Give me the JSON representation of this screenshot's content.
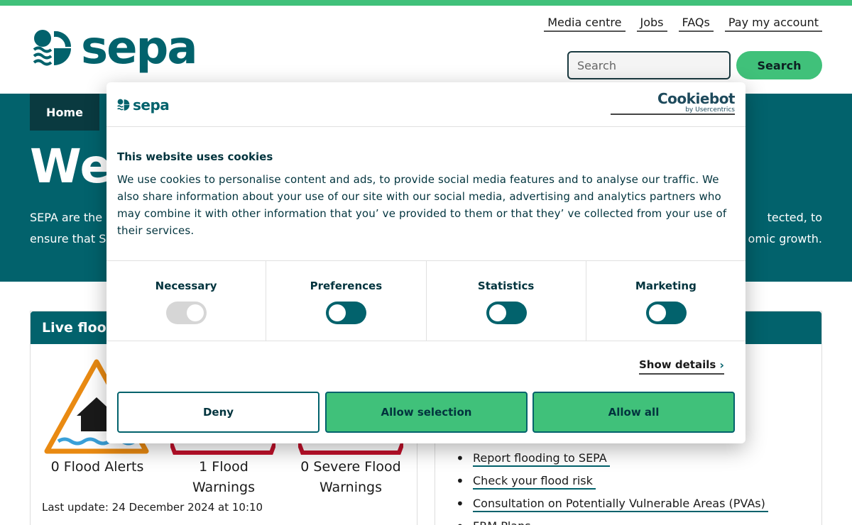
{
  "brand": {
    "logo_text": "sepa",
    "accent": "#40c17a",
    "primary": "#02626c",
    "dark": "#0a3a40"
  },
  "header": {
    "top_links": [
      "Media centre",
      "Jobs",
      "FAQs",
      "Pay my account"
    ],
    "search": {
      "placeholder": "Search",
      "button_label": "Search"
    }
  },
  "nav": {
    "home_label": "Home"
  },
  "hero": {
    "title": "We",
    "text_left_1": "SEPA are the S",
    "text_right_1": "tected, to",
    "text_left_2": "ensure that S",
    "text_right_2": "omic growth."
  },
  "flood": {
    "panel_title": "Live flood",
    "alerts": "0 Flood Alerts",
    "warnings_line1": "1 Flood",
    "warnings_line2": "Warnings",
    "severe_line1": "0 Severe Flood",
    "severe_line2": "Warnings",
    "last_update": "Last update: 24 December 2024 at 10:10"
  },
  "quick_links": [
    "Report flooding to SEPA",
    "Check your flood risk",
    "Consultation on Potentially Vulnerable Areas (PVAs)",
    "FRM Plans"
  ],
  "cookie_dialog": {
    "logo_text": "sepa",
    "provider_name": "Cookiebot",
    "provider_by": "by Usercentrics",
    "title": "This website uses cookies",
    "body": "We use cookies to personalise content and ads, to provide social media features and to analyse our traffic. We also share information about your use of our site with our social media, advertising and analytics partners who may combine it with other information that you’ ve provided to them or that they’ ve collected from your use of their services.",
    "categories": [
      {
        "label": "Necessary",
        "enabled": false,
        "disabled": true
      },
      {
        "label": "Preferences",
        "enabled": false,
        "disabled": false
      },
      {
        "label": "Statistics",
        "enabled": false,
        "disabled": false
      },
      {
        "label": "Marketing",
        "enabled": false,
        "disabled": false
      }
    ],
    "show_details": "Show details",
    "buttons": {
      "deny": "Deny",
      "allow_selection": "Allow selection",
      "allow_all": "Allow all"
    }
  }
}
